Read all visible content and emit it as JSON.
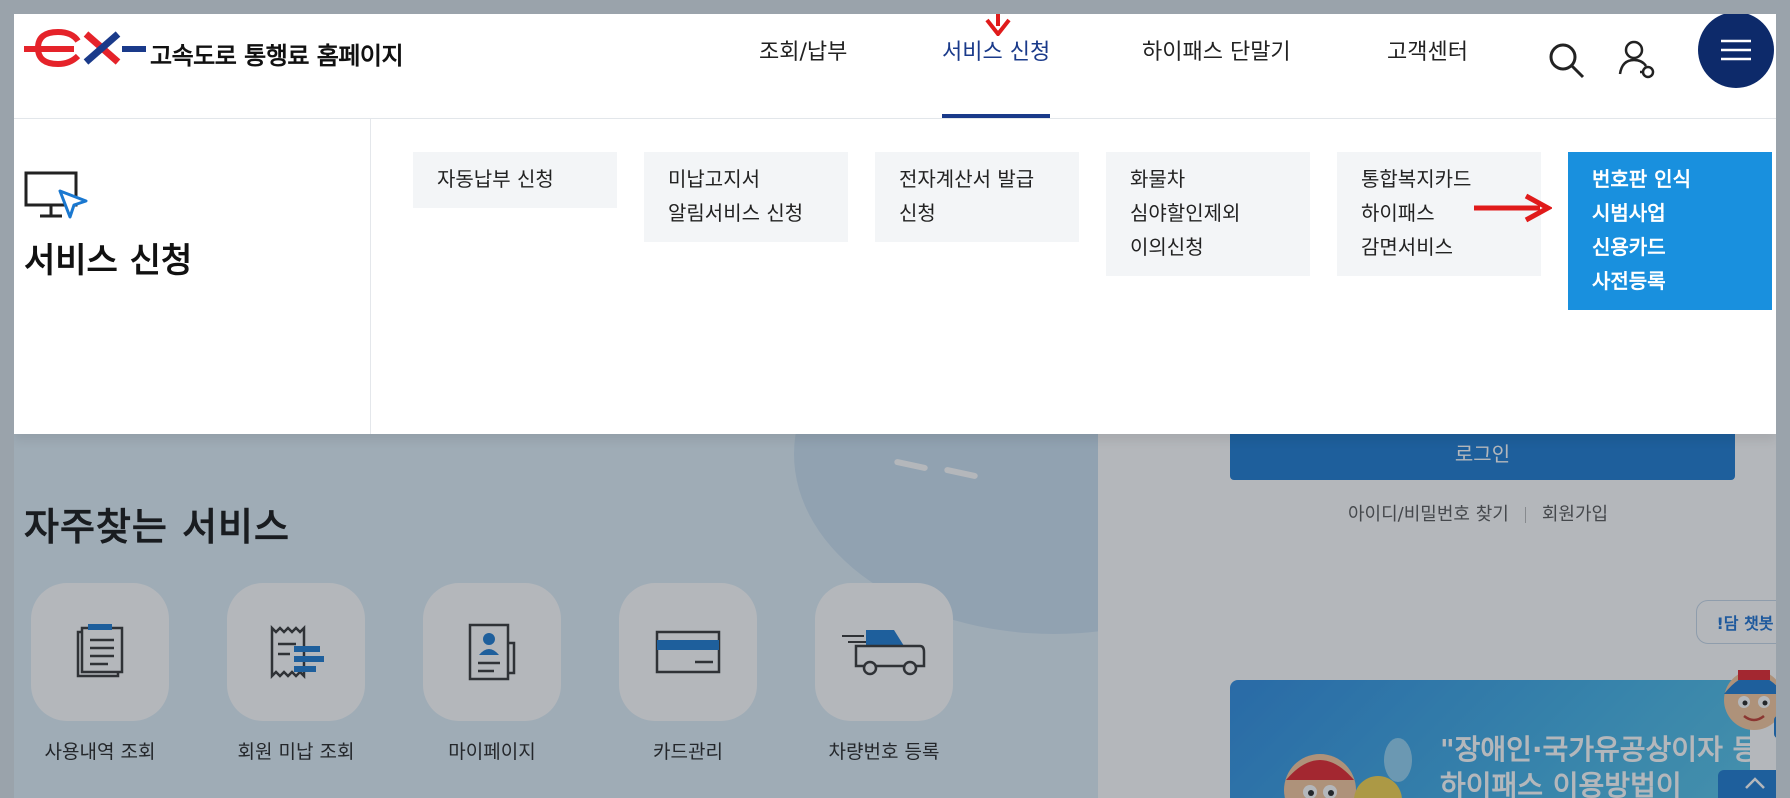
{
  "header": {
    "site_title": "고속도로 통행료 홈페이지",
    "nav": [
      {
        "label": "조회/납부"
      },
      {
        "label": "서비스 신청",
        "active": true
      },
      {
        "label": "하이패스 단말기"
      },
      {
        "label": "고객센터"
      }
    ],
    "icons": [
      "search-icon",
      "user-icon",
      "menu-icon"
    ]
  },
  "mega_menu": {
    "title": "서비스 신청",
    "items": [
      {
        "label": "자동납부 신청"
      },
      {
        "label": "미납고지서\n알림서비스 신청"
      },
      {
        "label": "전자계산서 발급\n신청"
      },
      {
        "label": "화물차\n심야할인제외\n이의신청"
      },
      {
        "label": "통합복지카드\n하이패스\n감면서비스"
      },
      {
        "label": "번호판 인식\n시범사업\n신용카드\n사전등록",
        "highlighted": true
      }
    ]
  },
  "background": {
    "heading": "자주찾는 서비스",
    "services": [
      {
        "label": "사용내역 조회",
        "icon": "document-list-icon"
      },
      {
        "label": "회원 미납 조회",
        "icon": "receipt-icon"
      },
      {
        "label": "마이페이지",
        "icon": "profile-card-icon"
      },
      {
        "label": "카드관리",
        "icon": "credit-card-icon"
      },
      {
        "label": "차량번호 등록",
        "icon": "vehicle-icon"
      }
    ],
    "login_button": "로그인",
    "find_account": "아이디/비밀번호 찾기",
    "signup": "회원가입",
    "chatbot_label": "!담 챗봇",
    "banner_line1": "\"장애인·국가유공상이자 등의",
    "banner_line2": "하이패스 이용방법이"
  },
  "colors": {
    "brand_red": "#e5232a",
    "brand_navy": "#1a3a8a",
    "highlight_blue": "#1990de",
    "menu_button": "#0d2a6a",
    "annotation_red": "#e01b1b"
  }
}
